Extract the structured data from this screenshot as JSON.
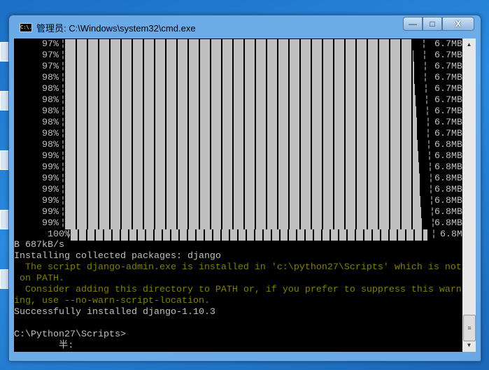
{
  "window": {
    "title": "管理员: C:\\Windows\\system32\\cmd.exe",
    "icon": "cmd-icon",
    "icon_text": "C:\\.",
    "minimize": "—",
    "maximize": "□",
    "close": "X"
  },
  "progress_rows": [
    {
      "percent": "97%",
      "size": "6.7MB"
    },
    {
      "percent": "97%",
      "size": "6.7MB"
    },
    {
      "percent": "97%",
      "size": "6.7MB"
    },
    {
      "percent": "98%",
      "size": "6.7MB"
    },
    {
      "percent": "98%",
      "size": "6.7MB"
    },
    {
      "percent": "98%",
      "size": "6.7MB"
    },
    {
      "percent": "98%",
      "size": "6.7MB"
    },
    {
      "percent": "98%",
      "size": "6.7MB"
    },
    {
      "percent": "98%",
      "size": "6.7MB"
    },
    {
      "percent": "98%",
      "size": "6.8MB"
    },
    {
      "percent": "99%",
      "size": "6.8MB"
    },
    {
      "percent": "99%",
      "size": "6.8MB"
    },
    {
      "percent": "99%",
      "size": "6.8MB"
    },
    {
      "percent": "99%",
      "size": "6.8MB"
    },
    {
      "percent": "99%",
      "size": "6.8MB"
    },
    {
      "percent": "99%",
      "size": "6.8MB"
    },
    {
      "percent": "99%",
      "size": "6.8MB"
    }
  ],
  "final_row": {
    "percent": "100%",
    "size": "6.8M"
  },
  "pipe": "¦",
  "lines": {
    "speed": "B 687kB/s",
    "installing": "Installing collected packages: django",
    "warn1": "  The script django-admin.exe is installed in 'c:\\python27\\Scripts' which is not",
    "warn2": " on PATH.",
    "warn3": "  Consider adding this directory to PATH or, if you prefer to suppress this warn",
    "warn4": "ing, use --no-warn-script-location.",
    "success": "Successfully installed django-1.10.3",
    "prompt": "C:\\Python27\\Scripts>",
    "ime": "        半:"
  },
  "colors": {
    "console_bg": "#000000",
    "text": "#c0c0c0",
    "warning": "#808000"
  }
}
